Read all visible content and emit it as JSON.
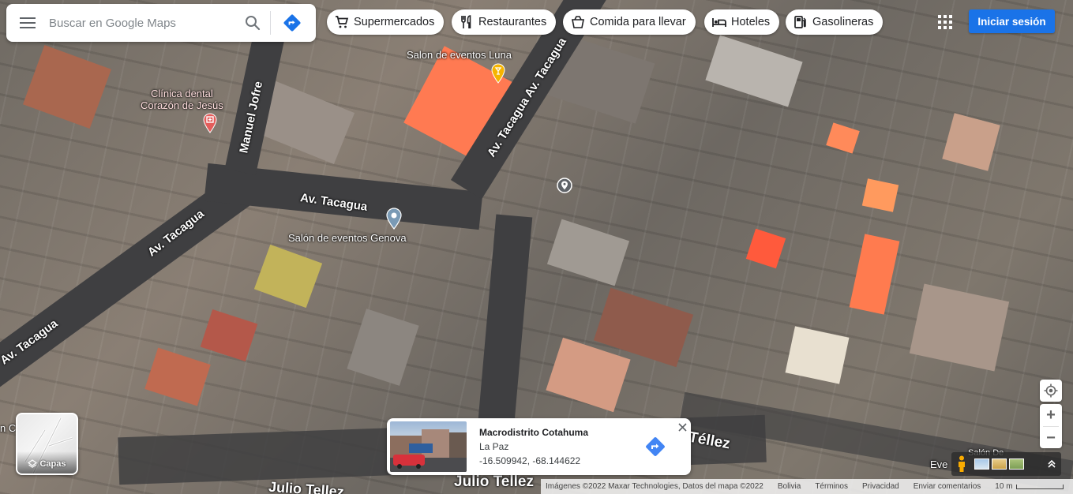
{
  "search": {
    "placeholder": "Buscar en Google Maps"
  },
  "icons": {
    "menu": "menu-icon",
    "search": "search-icon",
    "directions": "directions-icon",
    "apps": "apps-grid-icon",
    "layers": "layers-icon",
    "close": "close-icon",
    "locate": "my-location-icon",
    "pegman": "pegman-icon",
    "expand": "expand-icon"
  },
  "chips": [
    {
      "label": "Supermercados",
      "icon": "cart-icon"
    },
    {
      "label": "Restaurantes",
      "icon": "restaurant-icon"
    },
    {
      "label": "Comida para llevar",
      "icon": "takeout-icon"
    },
    {
      "label": "Hoteles",
      "icon": "hotel-icon"
    },
    {
      "label": "Gasolineras",
      "icon": "gas-station-icon"
    }
  ],
  "header": {
    "signin_label": "Iniciar sesión"
  },
  "map_labels": {
    "roads": {
      "manuel_jofre": "Manuel Jofre",
      "av_tacagua_1": "Av. Tacagua",
      "av_tacagua_2": "Av. Tacagua",
      "av_tacagua_3": "Av. Tacagua",
      "av_tacagua_4": "Av. Tacagua Av. Tacagua",
      "julio_tellez_1": "Julio Tellez",
      "julio_tellez_2": "Julio Tellez",
      "tellez": "Téllez"
    },
    "places": {
      "salon_luna": "Salon de eventos Luna",
      "clinica": "Clínica dental\nCorazón de Jesús",
      "salon_genova": "Salón de eventos Genova",
      "eve_partial": "Eve",
      "salon_partial": "Salón De",
      "left_partial": "n C"
    }
  },
  "layers": {
    "label": "Capas"
  },
  "info_card": {
    "title": "Macrodistrito Cotahuma",
    "subtitle": "La Paz",
    "coords": "-16.509942, -68.144622"
  },
  "zoom": {
    "in": "+",
    "out": "−"
  },
  "footer": {
    "imagery": "Imágenes ©2022 Maxar Technologies, Datos del mapa ©2022",
    "country": "Bolivia",
    "terms": "Términos",
    "privacy": "Privacidad",
    "feedback": "Enviar comentarios",
    "scale": "10 m"
  },
  "colors": {
    "brand_blue": "#1a73e8",
    "direction_blue": "#4285f4",
    "clinic_red": "#e35d5b",
    "pin_gold": "#f5b400"
  }
}
